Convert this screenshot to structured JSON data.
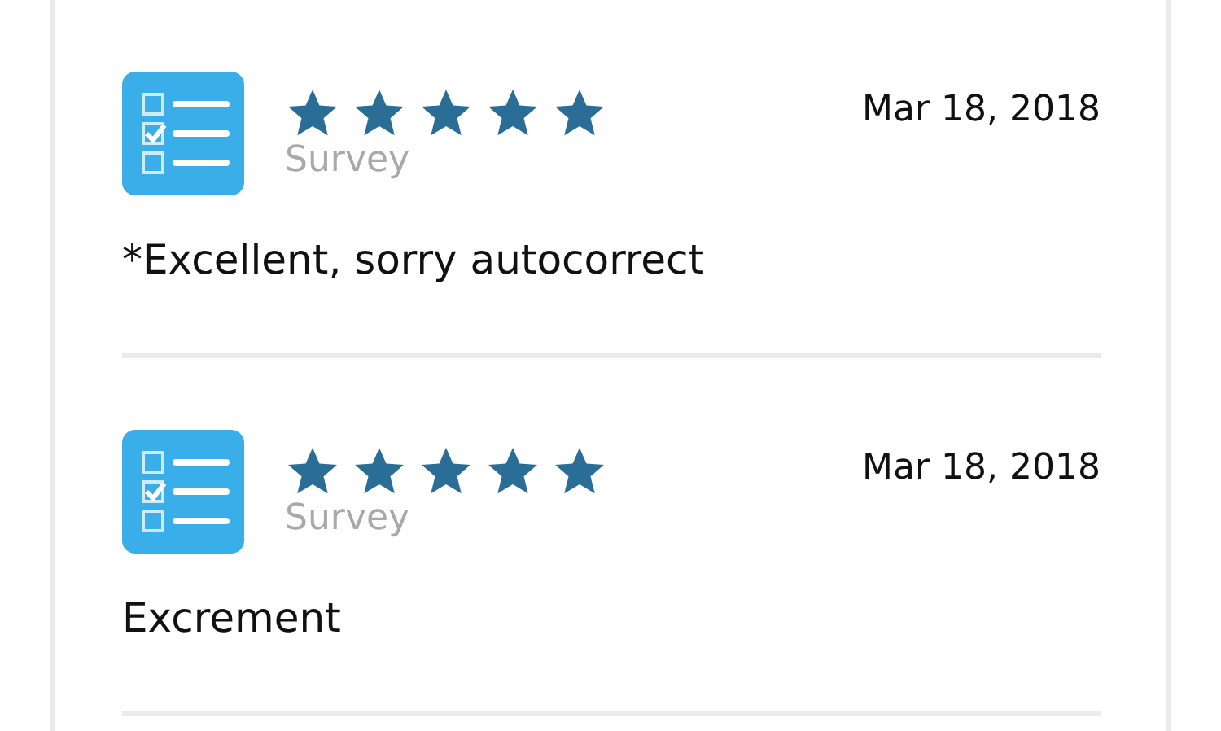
{
  "reviews": [
    {
      "stars": 5,
      "source": "Survey",
      "date": "Mar 18, 2018",
      "text": "*Excellent, sorry autocorrect"
    },
    {
      "stars": 5,
      "source": "Survey",
      "date": "Mar 18, 2018",
      "text": "Excrement"
    }
  ]
}
